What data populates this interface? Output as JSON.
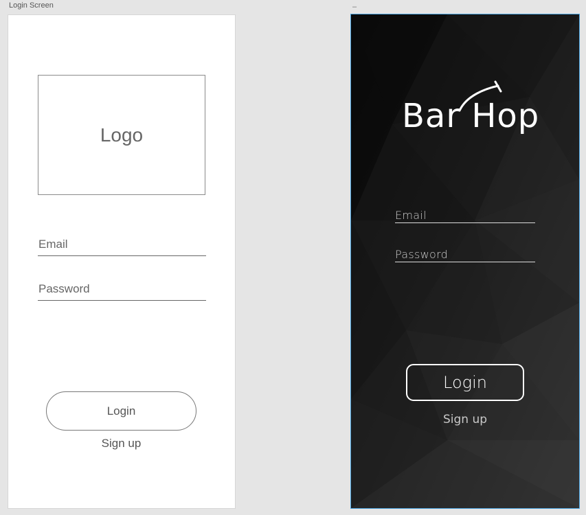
{
  "canvas": {
    "artboard_left_label": "Login Screen",
    "artboard_right_label": "–"
  },
  "wireframe": {
    "logo_placeholder": "Logo",
    "email_label": "Email",
    "password_label": "Password",
    "login_label": "Login",
    "signup_label": "Sign up"
  },
  "mockup": {
    "brand_name": "Bar Hop",
    "email_label": "Email",
    "password_label": "Password",
    "login_label": "Login",
    "signup_label": "Sign up"
  },
  "colors": {
    "canvas_bg": "#e5e5e5",
    "dark_bg": "#1e1e1e",
    "selection_border": "#4aa3df"
  }
}
